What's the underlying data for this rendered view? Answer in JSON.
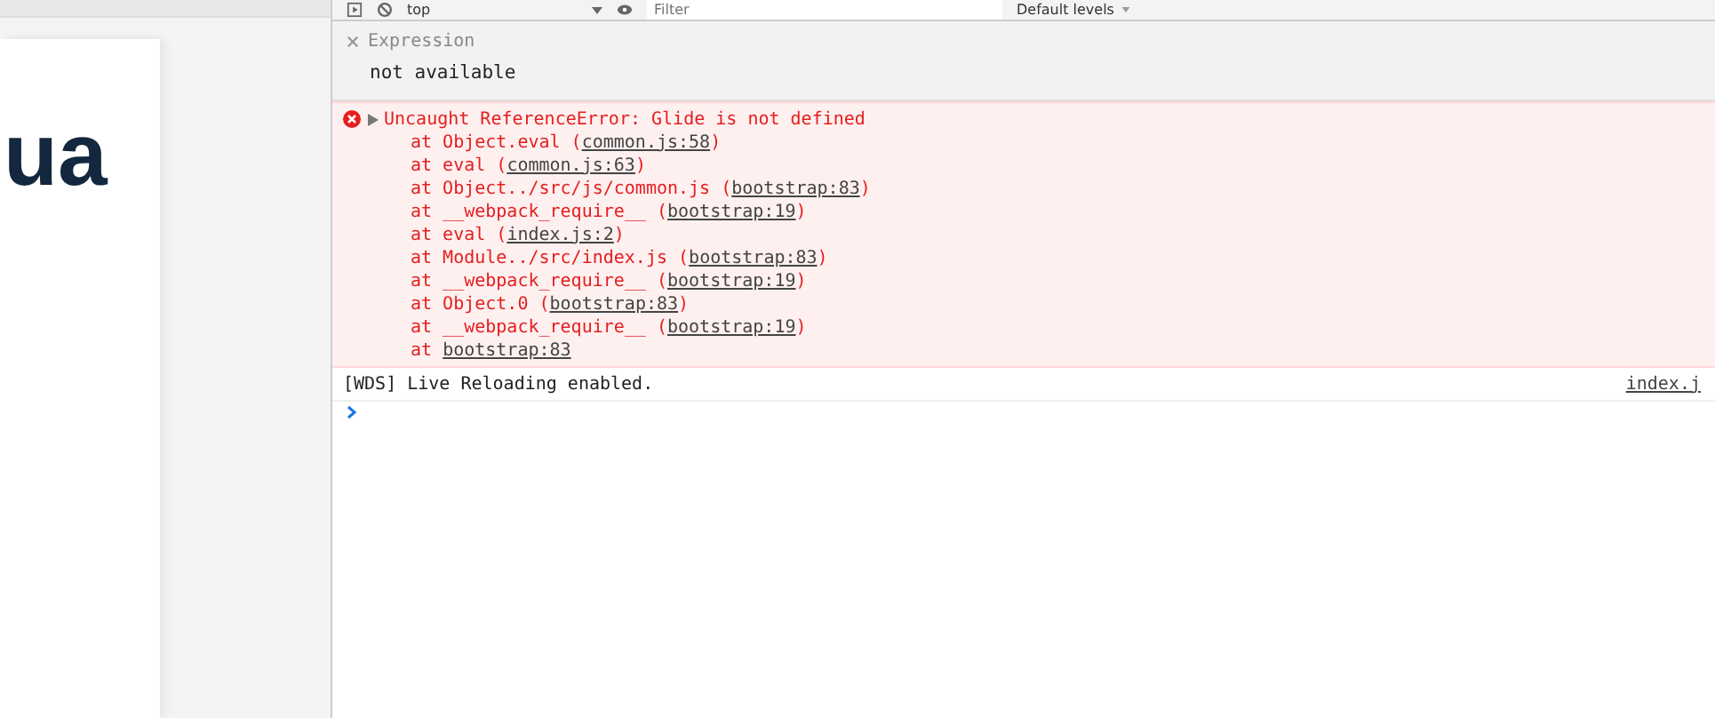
{
  "page": {
    "heading": "ua"
  },
  "toolbar": {
    "context": "top",
    "filter_placeholder": "Filter",
    "levels": "Default levels"
  },
  "expression": {
    "label": "Expression",
    "value": "not available"
  },
  "console": [
    {
      "kind": "error",
      "expanded": false,
      "text": "Uncaught ReferenceError: Glide is not defined",
      "stack": [
        {
          "prefix": "at Object.eval (",
          "link": "common.js:58",
          "suffix": ")"
        },
        {
          "prefix": "at eval (",
          "link": "common.js:63",
          "suffix": ")"
        },
        {
          "prefix": "at Object../src/js/common.js (",
          "link": "bootstrap:83",
          "suffix": ")"
        },
        {
          "prefix": "at __webpack_require__ (",
          "link": "bootstrap:19",
          "suffix": ")"
        },
        {
          "prefix": "at eval (",
          "link": "index.js:2",
          "suffix": ")"
        },
        {
          "prefix": "at Module../src/index.js (",
          "link": "bootstrap:83",
          "suffix": ")"
        },
        {
          "prefix": "at __webpack_require__ (",
          "link": "bootstrap:19",
          "suffix": ")"
        },
        {
          "prefix": "at Object.0 (",
          "link": "bootstrap:83",
          "suffix": ")"
        },
        {
          "prefix": "at __webpack_require__ (",
          "link": "bootstrap:19",
          "suffix": ")"
        },
        {
          "prefix": "at ",
          "link": "bootstrap:83"
        }
      ]
    },
    {
      "kind": "log",
      "text": "[WDS] Live Reloading enabled.",
      "source": "index.j"
    }
  ]
}
